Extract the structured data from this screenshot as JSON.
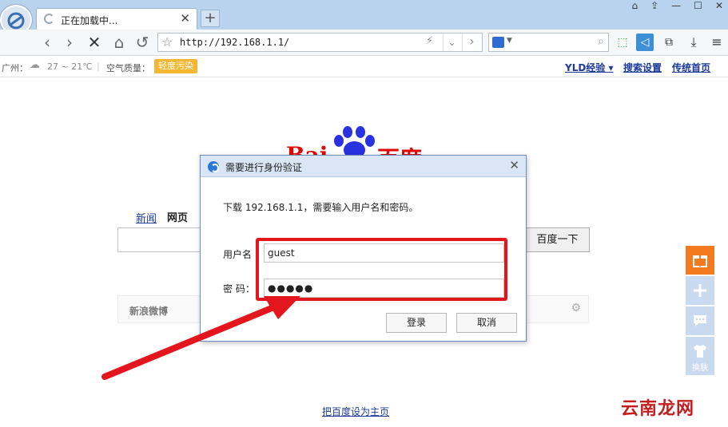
{
  "browser": {
    "tab_title": "正在加载中...",
    "tab_close": "✕",
    "new_tab": "+",
    "url": "http://192.168.1.1/",
    "window_buttons": [
      "⌂",
      "⇪",
      "—",
      "☐",
      "✕"
    ]
  },
  "infobar": {
    "city": "广州：",
    "temperature": "27 ~ 21℃",
    "air_label": "空气质量：",
    "air_value": "轻度污染",
    "user_link": "YLD经验 ▾",
    "link_settings": "搜索设置",
    "link_classic": "传统首页"
  },
  "page": {
    "logo_left": "Bai",
    "logo_right": "百度",
    "nav_news": "新闻",
    "nav_web": "网页",
    "search_button": "百度一下",
    "weibo_label": "新浪微博",
    "set_homepage": "把百度设为主页"
  },
  "side": {
    "skin_label": "换肤"
  },
  "dialog": {
    "title": "需要进行身份验证",
    "message": "下载 192.168.1.1，需要输入用户名和密码。",
    "username_label": "用户名",
    "username_value": "guest",
    "password_label": "密  码：",
    "password_value": "●●●●●",
    "login_button": "登录",
    "cancel_button": "取消"
  },
  "watermark": "云南龙网",
  "colors": {
    "annotation_red": "#e3161d",
    "baidu_red": "#e10601",
    "baidu_blue": "#2932e1",
    "air_badge": "#f5b731"
  }
}
